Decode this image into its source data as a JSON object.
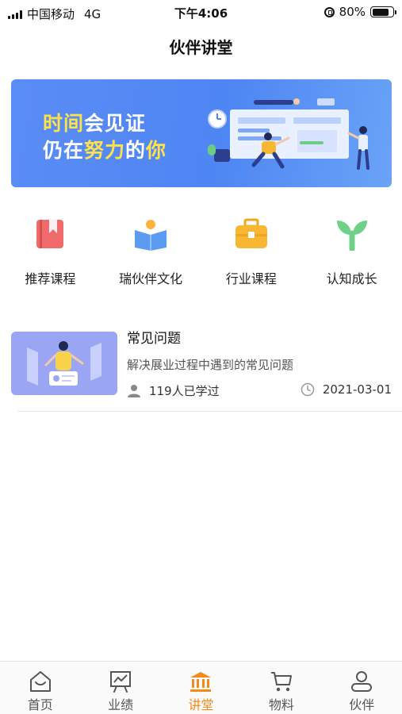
{
  "status_bar": {
    "carrier": "中国移动",
    "network": "4G",
    "time": "下午4:06",
    "battery_percent": "80%",
    "battery_level": 0.8
  },
  "header": {
    "title": "伙伴讲堂"
  },
  "banner": {
    "line1_part1": "时间",
    "line1_part2": "会见证",
    "line2_part1": "仍在",
    "line2_part2": "努力",
    "line2_part3": "的",
    "line2_part4": "你",
    "highlight_color": "#ffe247",
    "background_color": "#5b8cf6"
  },
  "categories": [
    {
      "label": "推荐课程",
      "icon": "bookmark-book-icon",
      "color": "#f06b6b"
    },
    {
      "label": "瑞伙伴文化",
      "icon": "reading-person-icon",
      "color": "#5b9cf2"
    },
    {
      "label": "行业课程",
      "icon": "briefcase-icon",
      "color": "#f7b733"
    },
    {
      "label": "认知成长",
      "icon": "sprout-icon",
      "color": "#6fd188"
    }
  ],
  "courses": [
    {
      "title": "常见问题",
      "description": "解决展业过程中遇到的常见问题",
      "learners": "119人已学过",
      "date": "2021-03-01"
    }
  ],
  "tabbar": {
    "items": [
      {
        "label": "首页",
        "icon": "home-icon"
      },
      {
        "label": "业绩",
        "icon": "chart-board-icon"
      },
      {
        "label": "讲堂",
        "icon": "bank-building-icon"
      },
      {
        "label": "物料",
        "icon": "cart-icon"
      },
      {
        "label": "伙伴",
        "icon": "person-icon"
      }
    ],
    "active_index": 2,
    "active_color": "#f28a1c"
  }
}
